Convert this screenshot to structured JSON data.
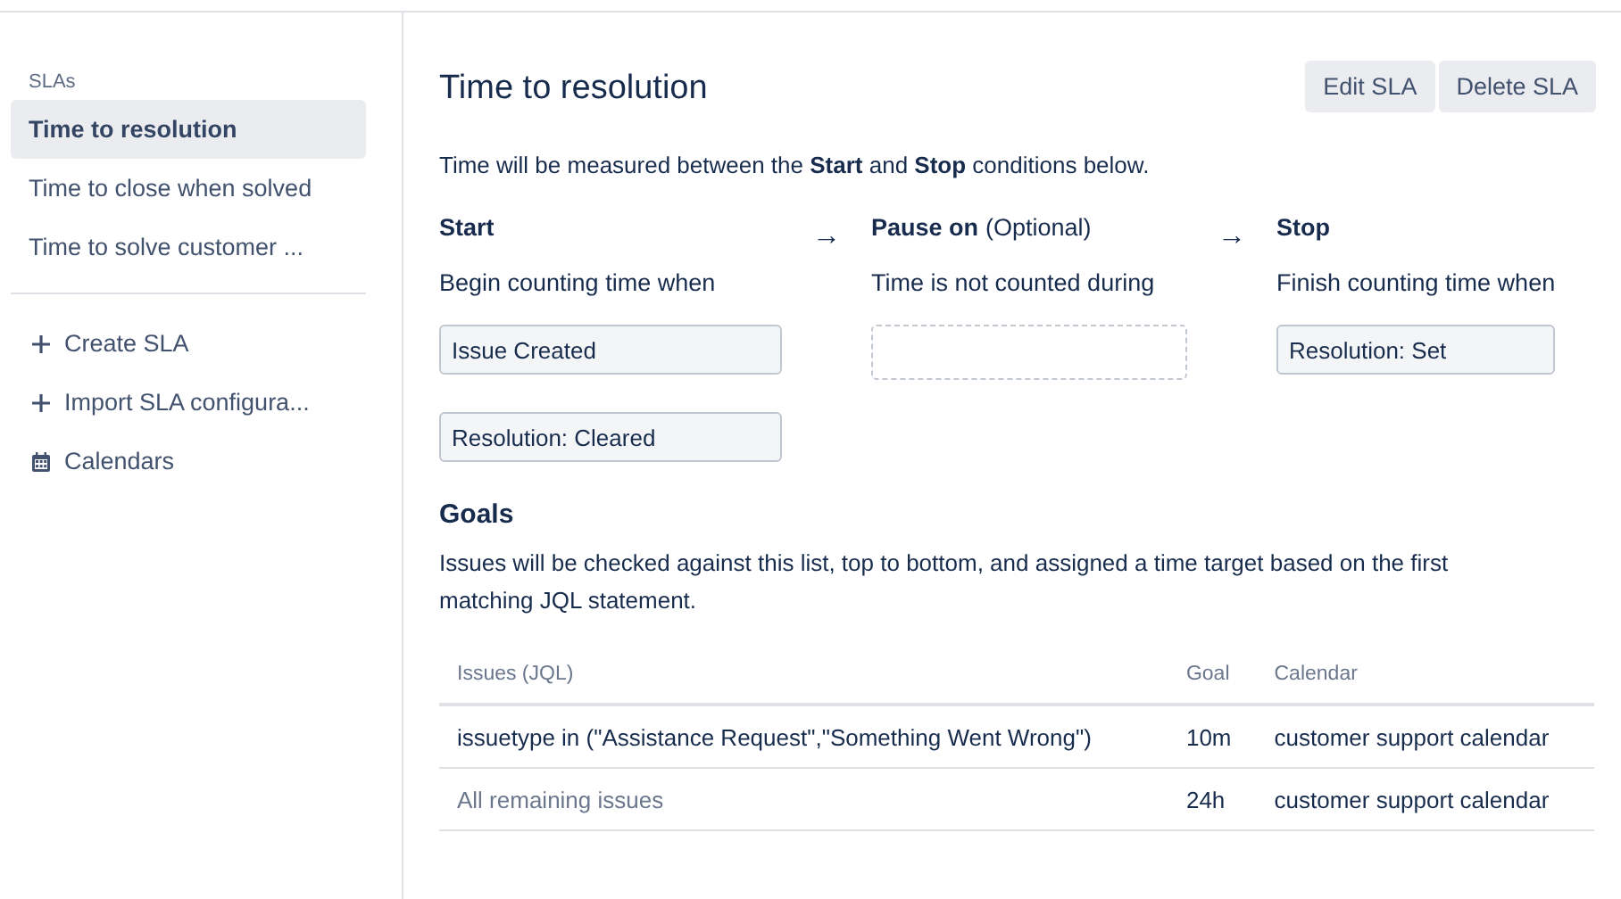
{
  "sidebar": {
    "heading": "SLAs",
    "items": [
      {
        "label": "Time to resolution",
        "selected": true
      },
      {
        "label": "Time to close when solved",
        "selected": false
      },
      {
        "label": "Time to solve customer ...",
        "selected": false
      }
    ],
    "actions": [
      {
        "kind": "add",
        "label": "Create SLA"
      },
      {
        "kind": "add",
        "label": "Import SLA configura..."
      },
      {
        "kind": "calendar",
        "label": "Calendars"
      }
    ]
  },
  "header": {
    "title": "Time to resolution",
    "buttons": [
      "Edit SLA",
      "Delete SLA"
    ]
  },
  "intro": "Time will be measured between the **Start** and **Stop** conditions below.",
  "conditions": [
    {
      "title": "Start",
      "description": "Begin counting time when",
      "values": [
        "Issue Created",
        "Resolution: Cleared"
      ]
    },
    {
      "arrow": "→",
      "title": "Pause on",
      "note": "(Optional)",
      "description": "Time is not counted during"
    },
    {
      "arrow": "→",
      "title": "Stop",
      "description": "Finish counting time when",
      "values": [
        "Resolution: Set"
      ]
    }
  ],
  "goals": {
    "title": "Goals",
    "description": "Issues will be checked against this list, top to bottom, and assigned a time target based on the first matching JQL statement.",
    "columns": [
      "Issues (JQL)",
      "Goal",
      "Calendar"
    ],
    "rows": [
      {
        "kind": "jql",
        "issues": "issuetype in (\"Assistance Request\",\"Something Went Wrong\")",
        "goal": "10m",
        "calendar": "customer support calendar"
      },
      {
        "kind": "remaining",
        "issues": "All remaining issues",
        "goal": "24h",
        "calendar": "customer support calendar"
      }
    ]
  }
}
